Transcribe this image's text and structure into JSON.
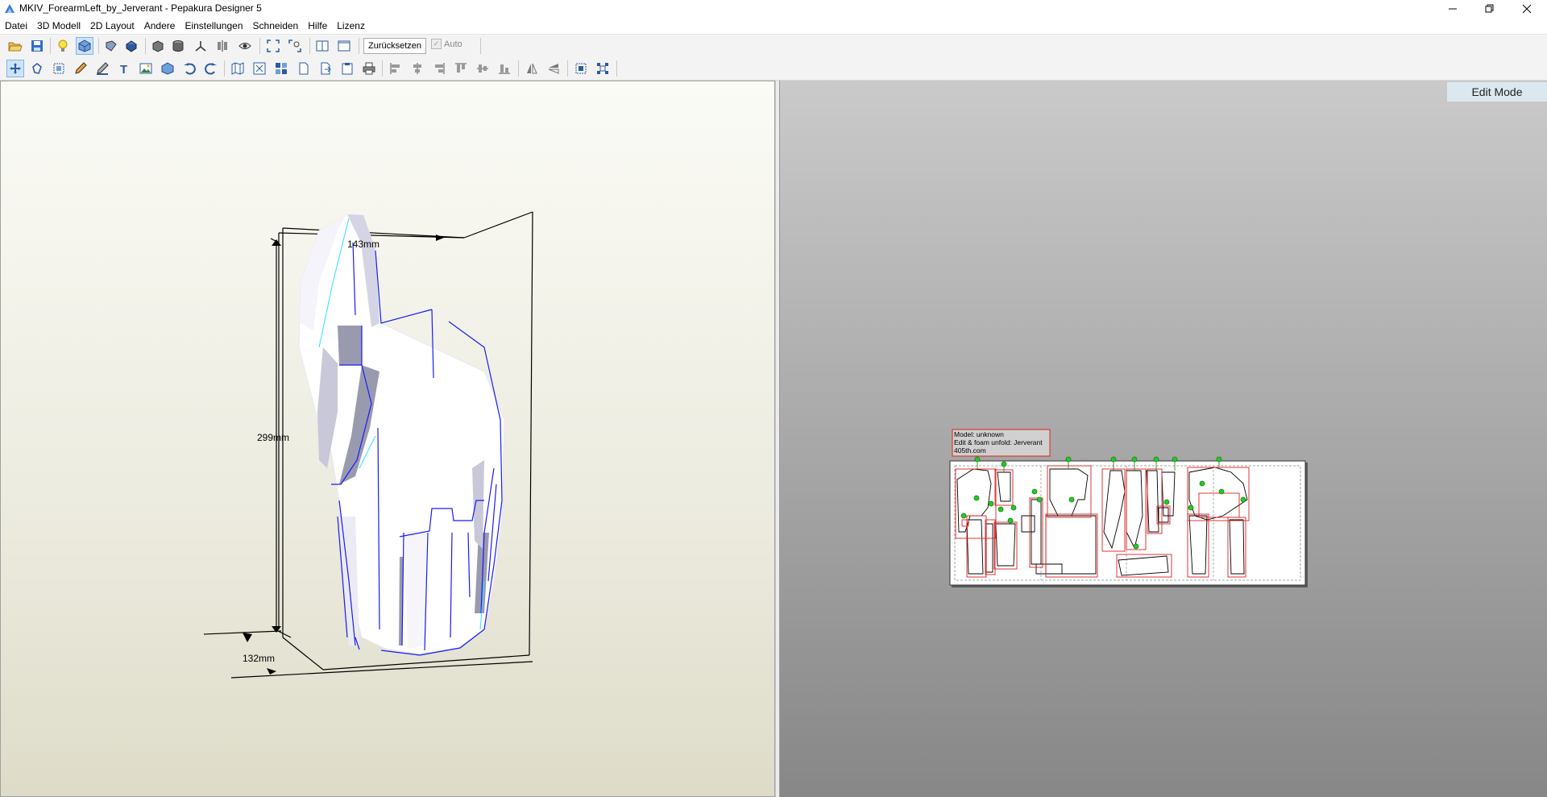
{
  "window": {
    "title": "MKIV_ForearmLeft_by_Jerverant - Pepakura Designer 5"
  },
  "menu": [
    "Datei",
    "3D Modell",
    "2D Layout",
    "Andere",
    "Einstellungen",
    "Schneiden",
    "Hilfe",
    "Lizenz"
  ],
  "toolbar": {
    "reset_label": "Zurücksetzen",
    "auto_label": "Auto",
    "auto_checked": true
  },
  "view3d": {
    "dim_width": "143mm",
    "dim_height": "299mm",
    "dim_depth": "132mm"
  },
  "view2d": {
    "mode_label": "Edit Mode",
    "info_lines": [
      "Model: unknown",
      "Edit & foam unfold: Jerverant",
      "405th.com"
    ]
  },
  "colors": {
    "accent": "#0a64c8",
    "edge_blue": "#1a1aff",
    "cut_red": "#e02020",
    "flap_green": "#22cc22"
  }
}
